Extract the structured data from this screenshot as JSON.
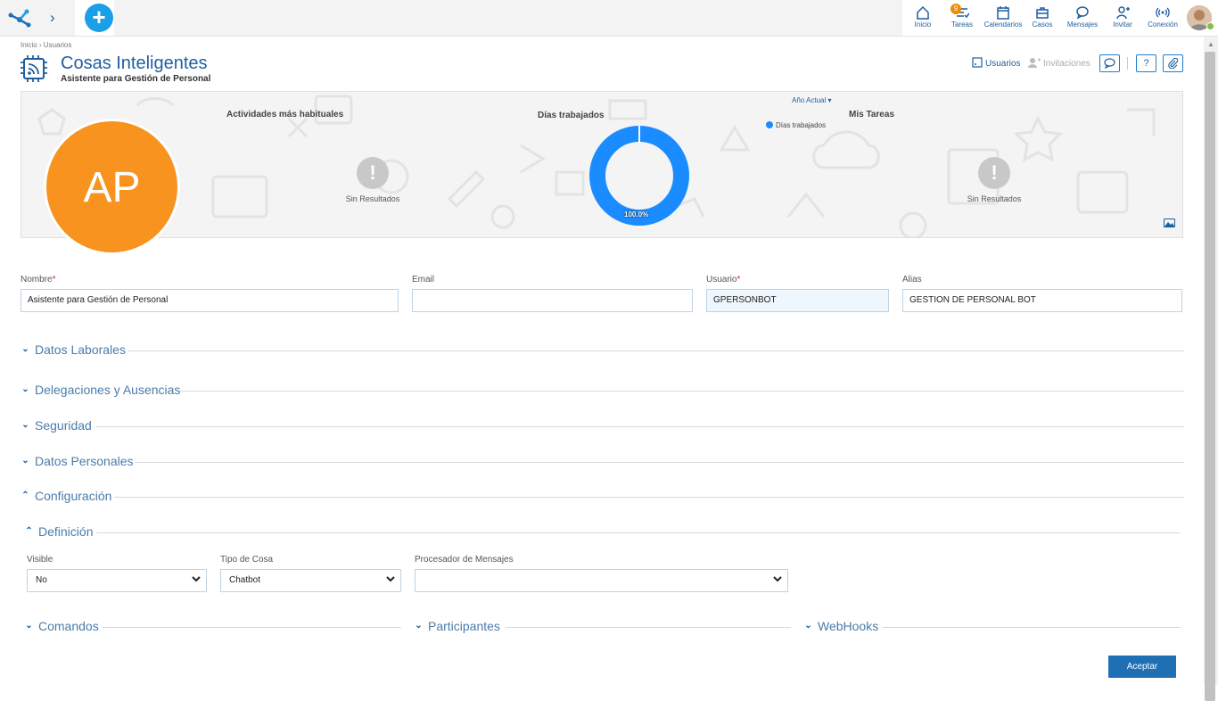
{
  "topbar": {
    "nav": [
      {
        "label": "Inicio",
        "icon": "home-icon"
      },
      {
        "label": "Tareas",
        "icon": "tasks-icon",
        "badge": "9"
      },
      {
        "label": "Calendarios",
        "icon": "calendar-icon"
      },
      {
        "label": "Casos",
        "icon": "briefcase-icon"
      },
      {
        "label": "Mensajes",
        "icon": "chat-icon"
      },
      {
        "label": "Invitar",
        "icon": "invite-icon"
      },
      {
        "label": "Conexión",
        "icon": "broadcast-icon"
      }
    ],
    "accent": "#1aa0e8"
  },
  "breadcrumb": "Inicio › Usuarios",
  "header": {
    "title": "Cosas Inteligentes",
    "subtitle": "Asistente para Gestión de Personal",
    "link_usuarios": "Usuarios",
    "link_invitaciones": "Invitaciones",
    "help_label": "?"
  },
  "banner": {
    "avatar_initials": "AP",
    "avatar_color": "#f7931e",
    "card1_title": "Actividades más habituales",
    "card1_empty": "Sin Resultados",
    "card2_title": "Días trabajados",
    "card2_period": "Año Actual",
    "card2_legend": "Días trabajados",
    "card2_value": "100.0%",
    "card3_title": "Mis Tareas",
    "card3_empty": "Sin Resultados"
  },
  "chart_data": {
    "type": "pie",
    "title": "Días trabajados",
    "categories": [
      "Días trabajados"
    ],
    "values": [
      100.0
    ],
    "legend": "top-right"
  },
  "form": {
    "nombre_label": "Nombre",
    "nombre_value": "Asistente para Gestión de Personal",
    "email_label": "Email",
    "email_value": "",
    "usuario_label": "Usuario",
    "usuario_value": "GPERSONBOT",
    "alias_label": "Alias",
    "alias_value": "GESTION DE PERSONAL BOT",
    "required_mark": "*"
  },
  "sections": {
    "datos_laborales": "Datos Laborales",
    "delegaciones": "Delegaciones y Ausencias",
    "seguridad": "Seguridad",
    "datos_personales": "Datos Personales",
    "configuracion": "Configuración",
    "definicion": "Definición",
    "comandos": "Comandos",
    "participantes": "Participantes",
    "webhooks": "WebHooks"
  },
  "definicion": {
    "visible_label": "Visible",
    "visible_value": "No",
    "tipo_label": "Tipo de Cosa",
    "tipo_value": "Chatbot",
    "procesador_label": "Procesador de Mensajes",
    "procesador_value": ""
  },
  "footer": {
    "accept_label": "Aceptar"
  }
}
